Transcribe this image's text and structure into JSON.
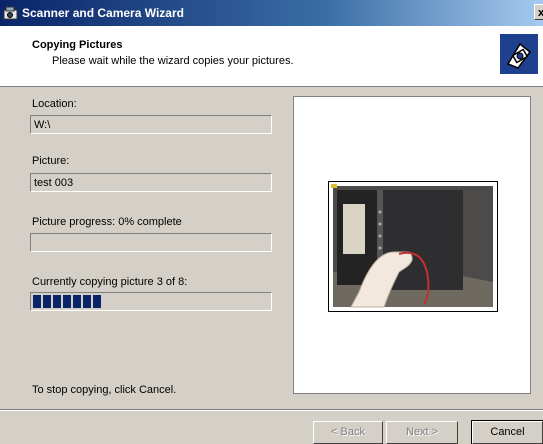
{
  "window": {
    "title": "Scanner and Camera Wizard",
    "close_label": "x"
  },
  "header": {
    "title": "Copying Pictures",
    "subtitle": "Please wait while the wizard copies your pictures."
  },
  "form": {
    "location_label": "Location:",
    "location_value": "W:\\",
    "picture_label": "Picture:",
    "picture_value": "test 003",
    "picture_progress_label": "Picture progress: 0% complete",
    "picture_progress_percent": 0,
    "overall_progress_label": "Currently copying picture 3 of 8:",
    "overall_progress_blocks": 7
  },
  "footer": {
    "hint": "To stop copying, click Cancel.",
    "back_label": "< Back",
    "next_label": "Next >",
    "cancel_label": "Cancel"
  },
  "colors": {
    "progress_fill": "#0a246a",
    "title_gradient_start": "#0a246a"
  }
}
